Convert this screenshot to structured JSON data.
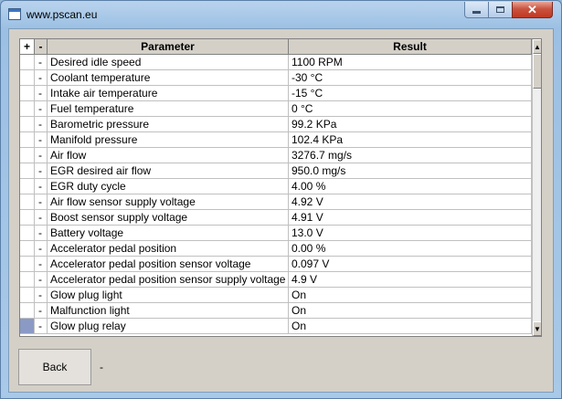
{
  "window": {
    "title": "www.pscan.eu",
    "close_glyph": "✕"
  },
  "grid": {
    "columns": [
      "+",
      "-",
      "Parameter",
      "Result"
    ],
    "rows": [
      {
        "toggle": "-",
        "parameter": "Desired idle speed",
        "result": "1100 RPM"
      },
      {
        "toggle": "-",
        "parameter": "Coolant temperature",
        "result": "-30 °C"
      },
      {
        "toggle": "-",
        "parameter": "Intake air temperature",
        "result": "-15 °C"
      },
      {
        "toggle": "-",
        "parameter": "Fuel temperature",
        "result": "0 °C"
      },
      {
        "toggle": "-",
        "parameter": "Barometric pressure",
        "result": "99.2 KPa"
      },
      {
        "toggle": "-",
        "parameter": "Manifold pressure",
        "result": "102.4 KPa"
      },
      {
        "toggle": "-",
        "parameter": "Air flow",
        "result": "3276.7 mg/s"
      },
      {
        "toggle": "-",
        "parameter": "EGR desired air flow",
        "result": "950.0 mg/s"
      },
      {
        "toggle": "-",
        "parameter": "EGR duty cycle",
        "result": "4.00 %"
      },
      {
        "toggle": "-",
        "parameter": "Air flow sensor supply voltage",
        "result": "4.92 V"
      },
      {
        "toggle": "-",
        "parameter": "Boost sensor supply voltage",
        "result": "4.91 V"
      },
      {
        "toggle": "-",
        "parameter": "Battery voltage",
        "result": "13.0 V"
      },
      {
        "toggle": "-",
        "parameter": "Accelerator pedal position",
        "result": "0.00 %"
      },
      {
        "toggle": "-",
        "parameter": "Accelerator pedal position sensor voltage",
        "result": "0.097 V"
      },
      {
        "toggle": "-",
        "parameter": "Accelerator pedal position sensor supply voltage",
        "result": "4.9 V"
      },
      {
        "toggle": "-",
        "parameter": "Glow plug light",
        "result": "On"
      },
      {
        "toggle": "-",
        "parameter": "Malfunction light",
        "result": "On"
      },
      {
        "toggle": "-",
        "parameter": "Glow plug relay",
        "result": "On"
      }
    ],
    "scroll_up_glyph": "▲",
    "scroll_down_glyph": "▼"
  },
  "footer": {
    "back_label": "Back",
    "status_text": "-"
  }
}
